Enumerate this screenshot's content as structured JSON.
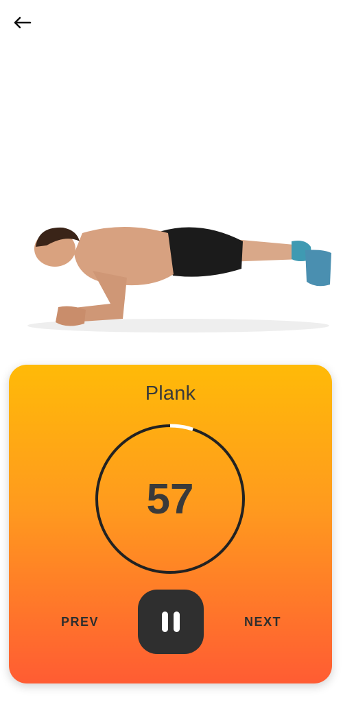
{
  "header": {
    "back_icon": "arrow-left-icon"
  },
  "exercise": {
    "name": "Plank",
    "illustration": "man-doing-plank-illustration"
  },
  "timer": {
    "value": "57",
    "progress_fraction": 0.05,
    "ring_color": "#222222",
    "progress_color": "#ffffff"
  },
  "controls": {
    "prev_label": "PREV",
    "next_label": "NEXT",
    "pause_icon": "pause-icon"
  },
  "colors": {
    "panel_gradient_top": "#FFBA08",
    "panel_gradient_bottom": "#FF5C33",
    "pause_button": "#2f2f2f"
  }
}
